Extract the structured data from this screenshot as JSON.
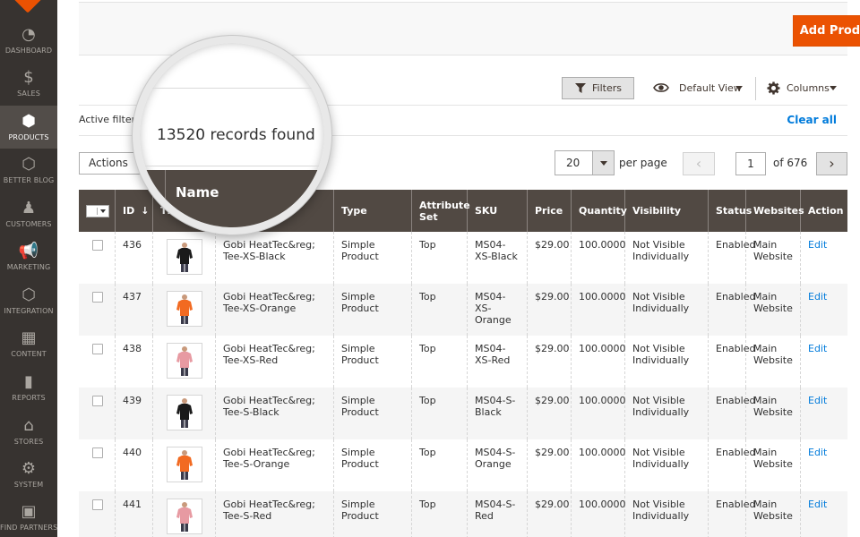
{
  "sidebar": {
    "items": [
      {
        "label": "DASHBOARD",
        "icon": "dashboard-icon",
        "glyph": "◔"
      },
      {
        "label": "SALES",
        "icon": "dollar-icon",
        "glyph": "$"
      },
      {
        "label": "PRODUCTS",
        "icon": "cube-icon",
        "glyph": "⬢",
        "active": true
      },
      {
        "label": "BETTER BLOG",
        "icon": "hexagon-icon",
        "glyph": "⬡"
      },
      {
        "label": "CUSTOMERS",
        "icon": "person-icon",
        "glyph": "♟"
      },
      {
        "label": "MARKETING",
        "icon": "megaphone-icon",
        "glyph": "📢"
      },
      {
        "label": "INTEGRATION",
        "icon": "hexagon-outline-icon",
        "glyph": "⬡"
      },
      {
        "label": "CONTENT",
        "icon": "layout-icon",
        "glyph": "▦"
      },
      {
        "label": "REPORTS",
        "icon": "bar-chart-icon",
        "glyph": "▮"
      },
      {
        "label": "STORES",
        "icon": "storefront-icon",
        "glyph": "⌂"
      },
      {
        "label": "SYSTEM",
        "icon": "gear-icon",
        "glyph": "⚙"
      },
      {
        "label": "FIND PARTNERS",
        "icon": "box-icon",
        "glyph": "▣"
      }
    ]
  },
  "header": {
    "add_product": "Add Product"
  },
  "toolbar": {
    "filters": "Filters",
    "default_view": "Default View",
    "columns": "Columns",
    "active_filters": "Active filters:",
    "clear_all": "Clear all"
  },
  "pager": {
    "actions": "Actions",
    "per_page_value": "20",
    "per_page_label": "per page",
    "current_page": "1",
    "of_pages": "of 676"
  },
  "magnifier": {
    "records_found": "13520 records found",
    "name_header": "Name"
  },
  "grid": {
    "columns": [
      "",
      "ID",
      "Thumbnail",
      "Name",
      "Type",
      "Attribute Set",
      "SKU",
      "Price",
      "Quantity",
      "Visibility",
      "Status",
      "Websites",
      "Action"
    ],
    "id_sort_arrow": "↓",
    "rows": [
      {
        "id": "436",
        "name": "Gobi HeatTec&reg; Tee-XS-Black",
        "type": "Simple Product",
        "attr": "Top",
        "sku": "MS04-XS-Black",
        "price": "$29.00",
        "qty": "100.0000",
        "visibility": "Not Visible Individually",
        "status": "Enabled",
        "websites": "Main Website",
        "action": "Edit",
        "shirt_color": "#1a1a1a"
      },
      {
        "id": "437",
        "name": "Gobi HeatTec&reg; Tee-XS-Orange",
        "type": "Simple Product",
        "attr": "Top",
        "sku": "MS04-XS-Orange",
        "price": "$29.00",
        "qty": "100.0000",
        "visibility": "Not Visible Individually",
        "status": "Enabled",
        "websites": "Main Website",
        "action": "Edit",
        "shirt_color": "#f26a21"
      },
      {
        "id": "438",
        "name": "Gobi HeatTec&reg; Tee-XS-Red",
        "type": "Simple Product",
        "attr": "Top",
        "sku": "MS04-XS-Red",
        "price": "$29.00",
        "qty": "100.0000",
        "visibility": "Not Visible Individually",
        "status": "Enabled",
        "websites": "Main Website",
        "action": "Edit",
        "shirt_color": "#e79aa2"
      },
      {
        "id": "439",
        "name": "Gobi HeatTec&reg; Tee-S-Black",
        "type": "Simple Product",
        "attr": "Top",
        "sku": "MS04-S-Black",
        "price": "$29.00",
        "qty": "100.0000",
        "visibility": "Not Visible Individually",
        "status": "Enabled",
        "websites": "Main Website",
        "action": "Edit",
        "shirt_color": "#1a1a1a"
      },
      {
        "id": "440",
        "name": "Gobi HeatTec&reg; Tee-S-Orange",
        "type": "Simple Product",
        "attr": "Top",
        "sku": "MS04-S-Orange",
        "price": "$29.00",
        "qty": "100.0000",
        "visibility": "Not Visible Individually",
        "status": "Enabled",
        "websites": "Main Website",
        "action": "Edit",
        "shirt_color": "#f26a21"
      },
      {
        "id": "441",
        "name": "Gobi HeatTec&reg; Tee-S-Red",
        "type": "Simple Product",
        "attr": "Top",
        "sku": "MS04-S-Red",
        "price": "$29.00",
        "qty": "100.0000",
        "visibility": "Not Visible Individually",
        "status": "Enabled",
        "websites": "Main Website",
        "action": "Edit",
        "shirt_color": "#e79aa2"
      }
    ]
  },
  "colors": {
    "accent": "#eb5202",
    "sidebar_bg": "#373330",
    "grid_header_bg": "#514943",
    "link": "#007bdb"
  }
}
